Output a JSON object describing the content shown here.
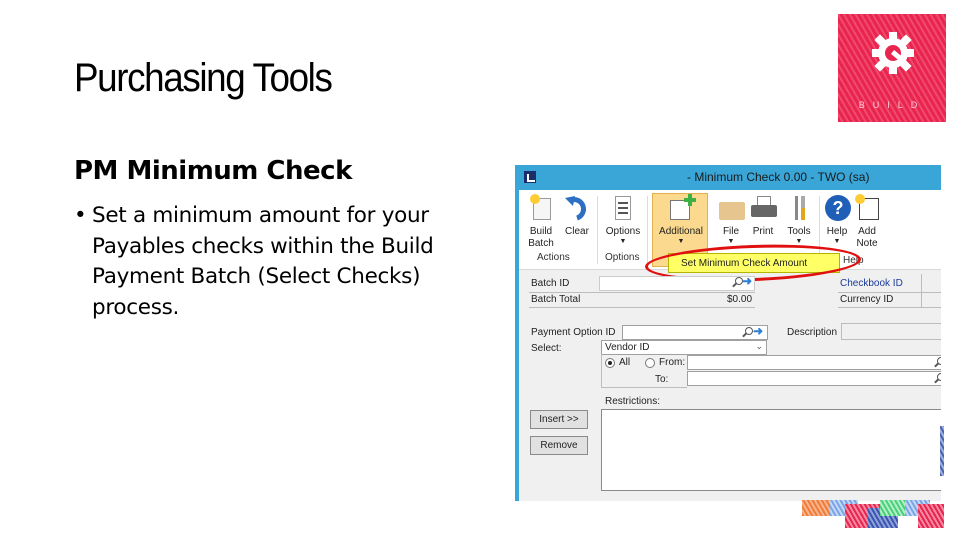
{
  "slide": {
    "title": "Purchasing Tools",
    "subtitle": "PM Minimum Check",
    "bullet": "•",
    "bullet_text": "Set a minimum amount for your Payables checks within the Build Payment Batch (Select Checks) process."
  },
  "logo": {
    "text": "BUILD",
    "icon": "gear-wrench-icon",
    "color": "#e8244f"
  },
  "window": {
    "title": "- Minimum Check 0.00  -  TWO (sa)",
    "accent_color": "#3aa6d8",
    "ribbon": {
      "buttons": [
        {
          "label": "Build",
          "label2": "Batch",
          "icon": "build-batch-icon"
        },
        {
          "label": "Clear",
          "icon": "clear-undo-icon"
        },
        {
          "label": "Options",
          "icon": "options-list-icon",
          "dropdown": "▼"
        },
        {
          "label": "Additional",
          "icon": "additional-window-icon",
          "dropdown": "▼"
        },
        {
          "label": "File",
          "icon": "folder-icon",
          "dropdown": "▼"
        },
        {
          "label": "Print",
          "icon": "printer-icon"
        },
        {
          "label": "Tools",
          "icon": "tools-icon",
          "dropdown": "▼"
        },
        {
          "label": "Help",
          "icon": "help-icon",
          "dropdown": "▼"
        },
        {
          "label": "Add",
          "label2": "Note",
          "icon": "add-note-icon"
        }
      ],
      "groups": [
        "Actions",
        "Options",
        "Help"
      ]
    },
    "menu_item": "Set Minimum Check Amount",
    "form": {
      "batch_id_label": "Batch ID",
      "batch_id_value": "",
      "batch_total_label": "Batch Total",
      "batch_total_value": "$0.00",
      "checkbook_id_label": "Checkbook ID",
      "currency_id_label": "Currency ID",
      "payment_option_label": "Payment Option ID",
      "payment_option_value": "",
      "description_label": "Description",
      "select_label": "Select:",
      "select_value": "Vendor ID",
      "radio_all": "All",
      "radio_from": "From:",
      "to_label": "To:",
      "restrictions_label": "Restrictions:",
      "insert_button": "Insert >>",
      "remove_button": "Remove"
    }
  }
}
